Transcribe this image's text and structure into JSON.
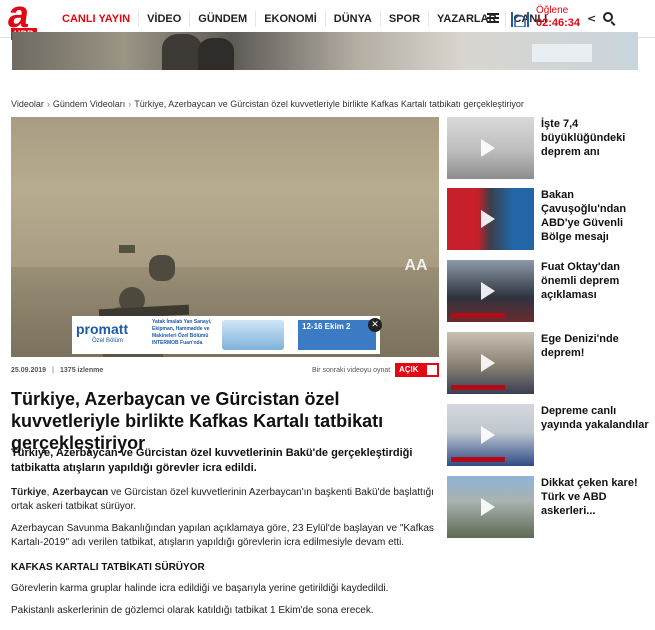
{
  "header": {
    "logo_letter": "a",
    "logo_sub": "HBR",
    "nav": [
      "CANLI YAYIN",
      "VİDEO",
      "GÜNDEM",
      "EKONOMİ",
      "DÜNYA",
      "SPOR",
      "YAZARLAR",
      "CANLI"
    ],
    "prayer_name": "Öğlene",
    "prayer_time": "02:46:34"
  },
  "breadcrumb": [
    "Videolar",
    "Gündem Videoları",
    "Türkiye, Azerbaycan ve Gürcistan özel kuvvetleriyle birlikte Kafkas Kartalı tatbikatı gerçekleştiriyor"
  ],
  "video": {
    "watermark": "AA",
    "ad_brand": "promatt",
    "ad_brand_sub": "Özel Bölüm",
    "ad_text": "Yatak İmalatı Yan Sanayi, Ekipman, Hammadde ve Makineleri Özel Bölümü INTERMOB Fuarı'nda",
    "ad_dates": "12-16 Ekim 2",
    "ad_close": "✕"
  },
  "meta": {
    "date": "25.09.2019",
    "views": "1375 izlenme",
    "next_label": "Bir sonraki videoyu oynat",
    "toggle_label": "AÇIK"
  },
  "article": {
    "headline": "Türkiye, Azerbaycan ve Gürcistan özel kuvvetleriyle birlikte Kafkas Kartalı tatbikatı gerçekleştiriyor",
    "summary": "Türkiye, Azerbaycan ve Gürcistan özel kuvvetlerinin Bakü'de gerçekleştirdiği tatbikatta atışların yapıldığı görevler icra edildi.",
    "p1_bold1": "Türkiye",
    "p1_sep": ", ",
    "p1_bold2": "Azerbaycan",
    "p1_rest": " ve Gürcistan özel kuvvetlerinin Azerbaycan'ın başkenti Bakü'de başlattığı ortak askeri tatbikat sürüyor.",
    "p2": "Azerbaycan Savunma Bakanlığından yapılan açıklamaya göre, 23 Eylül'de başlayan ve \"Kafkas Kartalı-2019\" adı verilen tatbikat, atışların yapıldığı görevlerin icra edilmesiyle devam etti.",
    "subhead": "KAFKAS KARTALI TATBİKATI SÜRÜYOR",
    "p3": "Görevlerin karma gruplar halinde icra edildiği ve başarıyla yerine getirildiği kaydedildi.",
    "p4": "Pakistanlı askerlerinin de gözlemci olarak katıldığı tatbikat 1 Ekim'de sona erecek."
  },
  "sidebar": [
    {
      "title": "İşte 7,4 büyüklüğündeki deprem anı"
    },
    {
      "title": "Bakan Çavuşoğlu'ndan ABD'ye Güvenli Bölge mesajı"
    },
    {
      "title": "Fuat Oktay'dan önemli deprem açıklaması"
    },
    {
      "title": "Ege Denizi'nde deprem!"
    },
    {
      "title": "Depreme canlı yayında yakalandılar"
    },
    {
      "title": "Dikkat çeken kare! Türk ve ABD askerleri..."
    }
  ],
  "colors": {
    "accent": "#e30613",
    "text": "#111111"
  }
}
